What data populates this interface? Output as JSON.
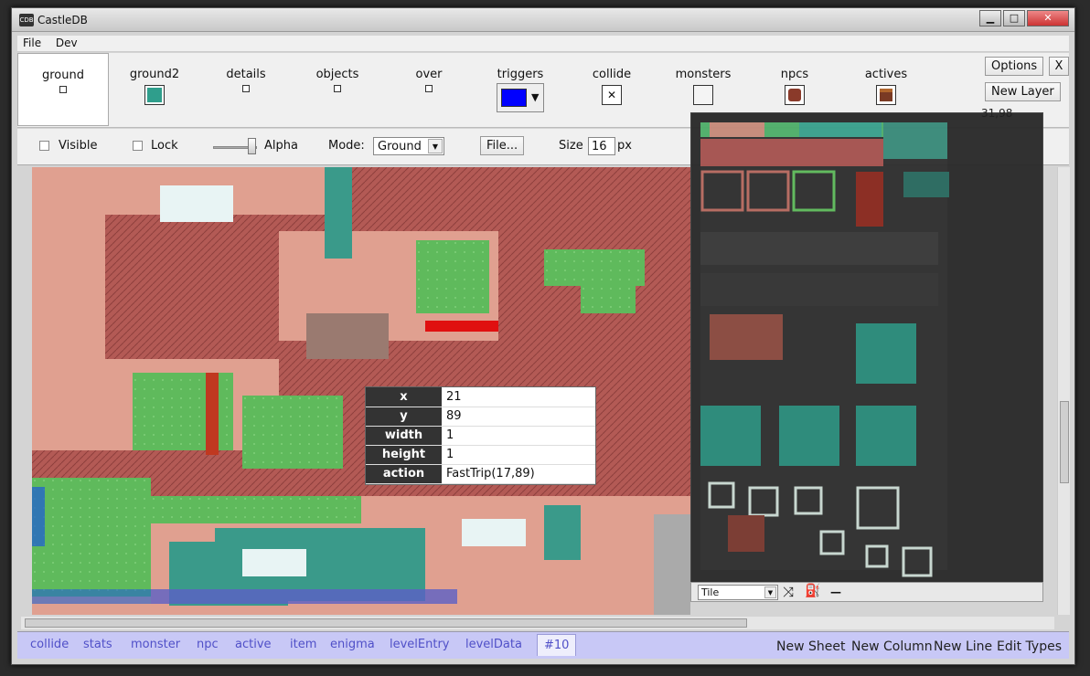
{
  "window": {
    "title": "CastleDB",
    "icon_label": "CDB"
  },
  "window_controls": {
    "minimize": "▁",
    "maximize": "□",
    "close": "✕"
  },
  "menu": [
    "File",
    "Dev"
  ],
  "layers": [
    {
      "name": "ground",
      "swatch": "#ffffff"
    },
    {
      "name": "ground2",
      "swatch": "#2f9e8c"
    },
    {
      "name": "details",
      "swatch": "#ffffff"
    },
    {
      "name": "objects",
      "swatch": "#ffffff"
    },
    {
      "name": "over",
      "swatch": "#ffffff"
    },
    {
      "name": "triggers",
      "swatch": "#0000ff"
    },
    {
      "name": "collide",
      "swatch": "#ffffff",
      "glyph": "✕"
    },
    {
      "name": "monsters",
      "swatch": "#ffffff"
    },
    {
      "name": "npcs",
      "swatch": "#8a3a2a"
    },
    {
      "name": "actives",
      "swatch": "#7a3a24"
    }
  ],
  "header_buttons": {
    "options": "Options",
    "close": "X",
    "new_layer": "New Layer"
  },
  "coords": "31,98",
  "toolbar": {
    "visible": "Visible",
    "lock": "Lock",
    "alpha": "Alpha",
    "alpha_level": 0.9,
    "mode_label": "Mode:",
    "mode_value": "Ground",
    "file_button": "File...",
    "size_label": "Size",
    "size_value": "16",
    "size_unit": "px"
  },
  "tooltip": {
    "rows": [
      {
        "key": "x",
        "value": "21"
      },
      {
        "key": "y",
        "value": "89"
      },
      {
        "key": "width",
        "value": "1"
      },
      {
        "key": "height",
        "value": "1"
      },
      {
        "key": "action",
        "value": "FastTrip(17,89)"
      }
    ]
  },
  "palette": {
    "mode_select": "Tile",
    "random_icon": "⤨",
    "bucket_icon": "⛽",
    "minus": "—"
  },
  "sheets": [
    "collide",
    "stats",
    "monster",
    "npc",
    "active",
    "item",
    "enigma",
    "levelEntry",
    "levelData",
    "#10"
  ],
  "active_sheet": "#10",
  "sheet_actions": [
    "New Sheet",
    "New Column",
    "New Line",
    "Edit Types"
  ],
  "colors": {
    "ground": "#b35a55",
    "sand": "#e0a090",
    "grass": "#5fba5c",
    "water": "#3a9a8a",
    "snow": "#e8f4f4",
    "sheet_bar": "#c8c8f6",
    "sheet_text": "#5050c8"
  }
}
